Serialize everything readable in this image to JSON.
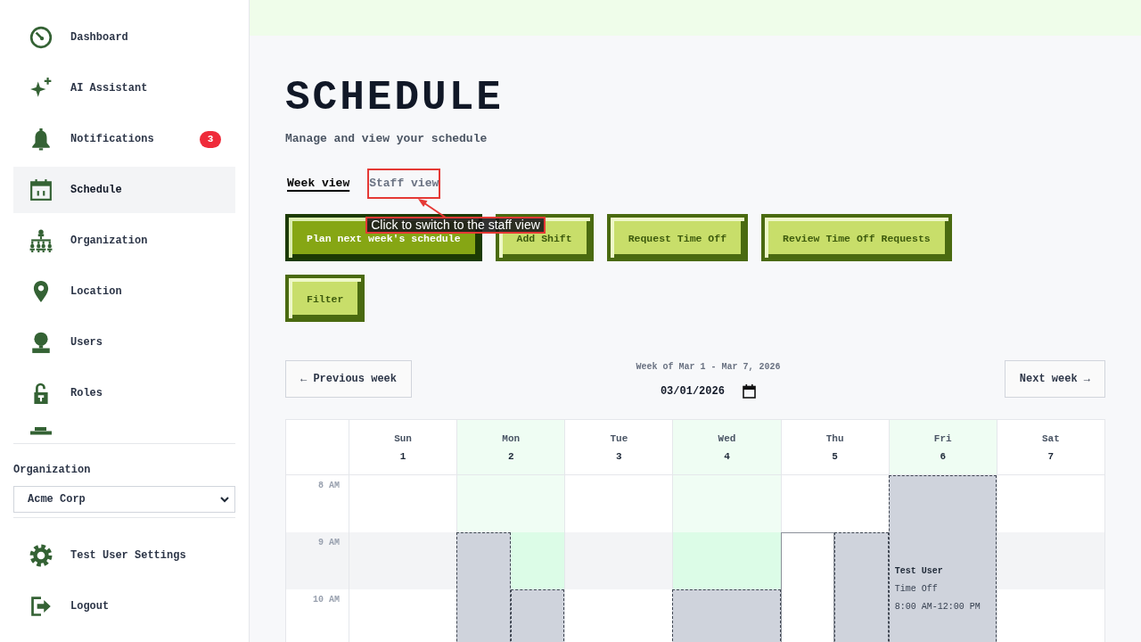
{
  "sidebar": {
    "nav_items": [
      {
        "label": "Dashboard",
        "selected": false
      },
      {
        "label": "AI Assistant",
        "selected": false
      },
      {
        "label": "Notifications",
        "selected": false,
        "badge": "3"
      },
      {
        "label": "Schedule",
        "selected": true
      },
      {
        "label": "Organization",
        "selected": false
      },
      {
        "label": "Location",
        "selected": false
      },
      {
        "label": "Users",
        "selected": false
      },
      {
        "label": "Roles",
        "selected": false
      }
    ],
    "organization": {
      "label": "Organization",
      "value": "Acme Corp"
    },
    "footer_items": [
      {
        "label": "Test User Settings"
      },
      {
        "label": "Logout"
      }
    ]
  },
  "page": {
    "title": "SCHEDULE",
    "subtitle": "Manage and view your schedule",
    "view_tabs": [
      {
        "label": "Week view",
        "selected": true
      },
      {
        "label": "Staff view",
        "selected": false,
        "callout": "Click to switch to the staff view"
      }
    ],
    "actions": [
      {
        "label": "Plan next week's schedule",
        "kind": "primary"
      },
      {
        "label": "Add Shift",
        "kind": "secondary"
      },
      {
        "label": "Request Time Off",
        "kind": "secondary"
      },
      {
        "label": "Review Time Off Requests",
        "kind": "secondary"
      },
      {
        "label": "Filter",
        "kind": "secondary"
      }
    ],
    "week_nav": {
      "previous": "← Previous week",
      "range": "Week of Mar 1 - Mar 7, 2026",
      "date": "03/01/2026",
      "next": "Next week →"
    },
    "calendar": {
      "days": [
        {
          "name": "Sun",
          "date": "1",
          "highlighted": false
        },
        {
          "name": "Mon",
          "date": "2",
          "highlighted": true
        },
        {
          "name": "Tue",
          "date": "3",
          "highlighted": false
        },
        {
          "name": "Wed",
          "date": "4",
          "highlighted": true
        },
        {
          "name": "Thu",
          "date": "5",
          "highlighted": false
        },
        {
          "name": "Fri",
          "date": "6",
          "highlighted": true
        },
        {
          "name": "Sat",
          "date": "7",
          "highlighted": false
        }
      ],
      "hours": [
        {
          "label": "8 AM",
          "shaded": false,
          "cells": [
            {},
            {},
            {},
            {},
            {},
            {
              "full": {
                "kind": "time_off",
                "name": "Test User",
                "type": "Time Off",
                "time": "8:00 AM-12:00 PM"
              }
            },
            {}
          ]
        },
        {
          "label": "9 AM",
          "shaded": true,
          "cells": [
            {},
            {
              "left": {
                "kind": "shift"
              }
            },
            {},
            {},
            {
              "left": {
                "kind": "draft"
              },
              "right": {
                "kind": "shift"
              }
            },
            {},
            {}
          ]
        },
        {
          "label": "10 AM",
          "shaded": false,
          "cells": [
            {},
            {
              "right": {
                "kind": "shift"
              }
            },
            {},
            {
              "full": {
                "kind": "shift"
              }
            },
            {},
            {},
            {}
          ]
        }
      ]
    }
  }
}
